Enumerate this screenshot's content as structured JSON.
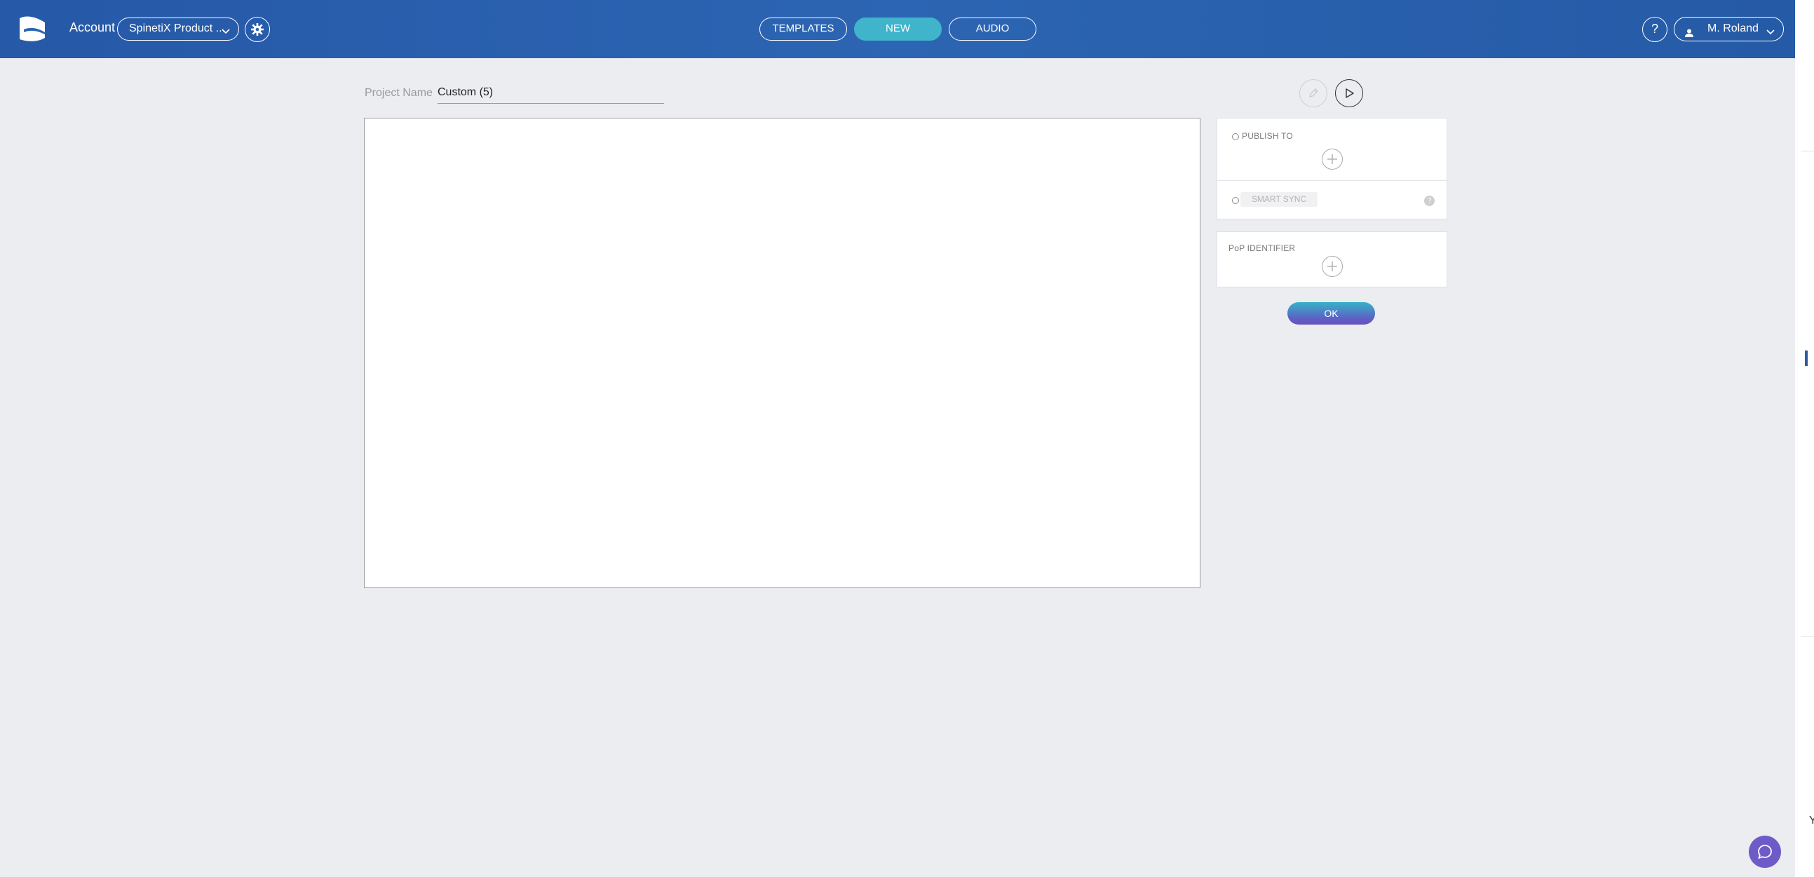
{
  "header": {
    "account_label": "Account",
    "account_selected": "SpinetiX Product ...",
    "nav": [
      {
        "label": "TEMPLATES",
        "active": false
      },
      {
        "label": "NEW",
        "active": true
      },
      {
        "label": "AUDIO",
        "active": false
      }
    ],
    "help_label": "?",
    "user_name": "M. Roland"
  },
  "project": {
    "name_label": "Project Name",
    "name_value": "Custom (5)"
  },
  "panel": {
    "publish_to_label": "PUBLISH TO",
    "smart_sync_label": "SMART SYNC",
    "sync_help_label": "?",
    "pop_identifier_label": "PoP IDENTIFIER",
    "ok_label": "OK"
  },
  "edge": {
    "partial_char": "Y"
  },
  "colors": {
    "header_bg": "#2c65b3",
    "active_pill": "#3fb4cb",
    "page_bg": "#ebedf1",
    "chat_bubble": "#6f5bc8"
  }
}
